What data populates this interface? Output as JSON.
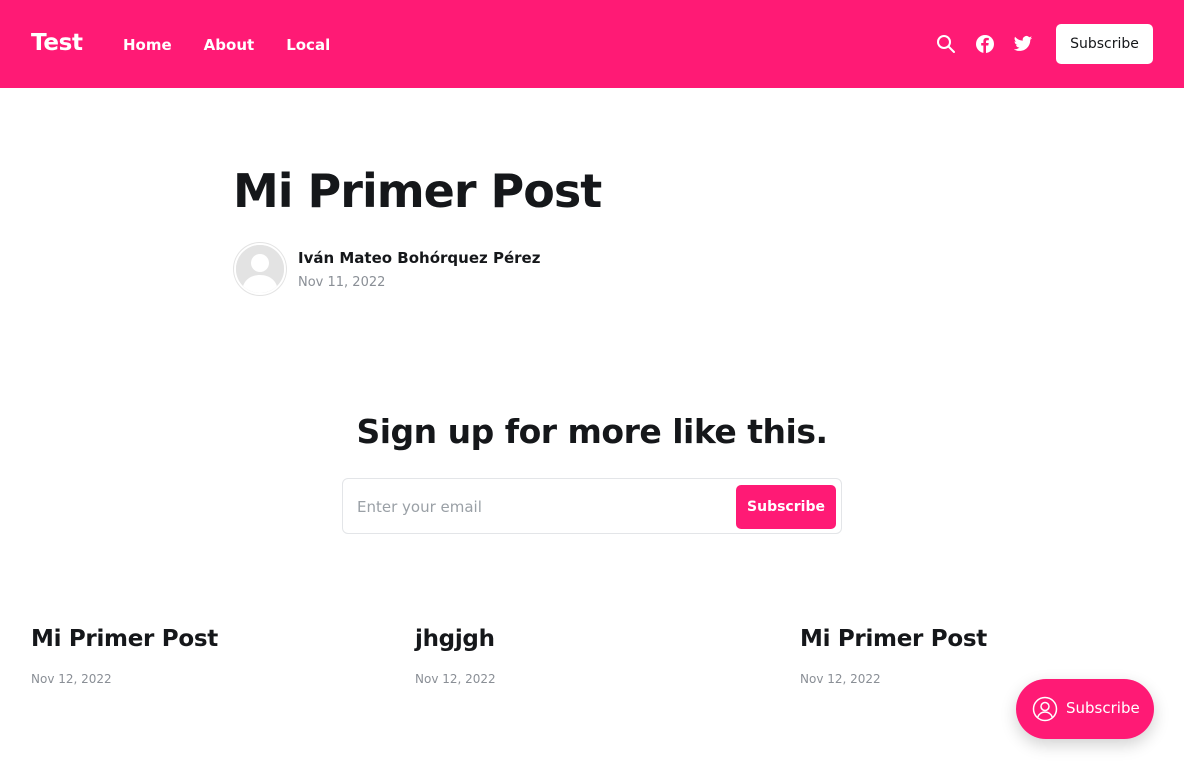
{
  "header": {
    "logo": "Test",
    "nav": [
      "Home",
      "About",
      "Local"
    ],
    "subscribe_label": "Subscribe",
    "icons": [
      "search-icon",
      "facebook-icon",
      "twitter-icon"
    ],
    "background": "#ff1a75"
  },
  "post": {
    "title": "Mi Primer Post",
    "author": "Iván Mateo Bohórquez Pérez",
    "date": "Nov 11, 2022"
  },
  "cta": {
    "title": "Sign up for more like this.",
    "email_placeholder": "Enter your email",
    "button_label": "Subscribe"
  },
  "related_posts": [
    {
      "title": "Mi Primer Post",
      "date": "Nov 12, 2022"
    },
    {
      "title": "jhgjgh",
      "date": "Nov 12, 2022"
    },
    {
      "title": "Mi Primer Post",
      "date": "Nov 12, 2022"
    }
  ],
  "portal": {
    "label": "Subscribe",
    "icon": "user-circle-icon"
  },
  "colors": {
    "accent": "#ff1a75",
    "text": "#15171a",
    "muted": "#8a8f96"
  }
}
